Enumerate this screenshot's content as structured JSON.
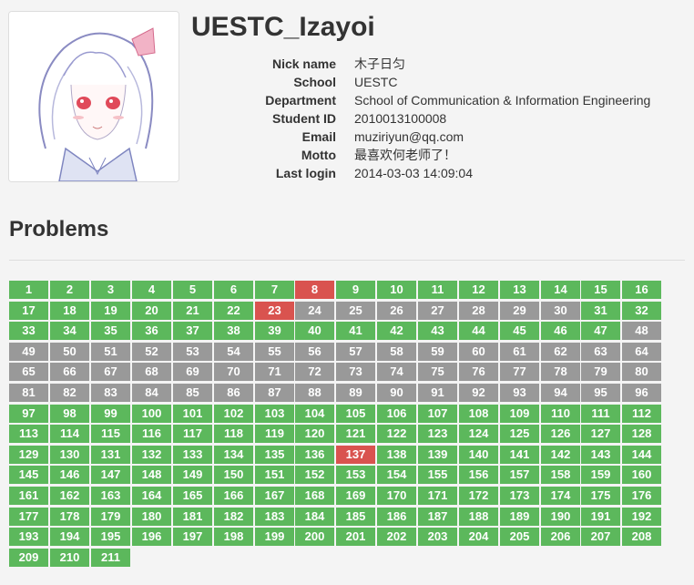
{
  "profile": {
    "username": "UESTC_Izayoi",
    "fields": [
      {
        "label": "Nick name",
        "value": "木子日匀"
      },
      {
        "label": "School",
        "value": "UESTC"
      },
      {
        "label": "Department",
        "value": "School of Communication & Information Engineering"
      },
      {
        "label": "Student ID",
        "value": "2010013100008"
      },
      {
        "label": "Email",
        "value": "muziriyun@qq.com"
      },
      {
        "label": "Motto",
        "value": "最喜欢何老师了！"
      },
      {
        "label": "Last login",
        "value": "2014-03-03 14:09:04"
      }
    ]
  },
  "problems": {
    "title": "Problems",
    "columns": 16,
    "colors": {
      "solved": "#5cb85c",
      "failed": "#d9534f",
      "unseen": "#999999"
    },
    "items": [
      {
        "id": "1",
        "status": "solved"
      },
      {
        "id": "2",
        "status": "solved"
      },
      {
        "id": "3",
        "status": "solved"
      },
      {
        "id": "4",
        "status": "solved"
      },
      {
        "id": "5",
        "status": "solved"
      },
      {
        "id": "6",
        "status": "solved"
      },
      {
        "id": "7",
        "status": "solved"
      },
      {
        "id": "8",
        "status": "failed"
      },
      {
        "id": "9",
        "status": "solved"
      },
      {
        "id": "10",
        "status": "solved"
      },
      {
        "id": "11",
        "status": "solved"
      },
      {
        "id": "12",
        "status": "solved"
      },
      {
        "id": "13",
        "status": "solved"
      },
      {
        "id": "14",
        "status": "solved"
      },
      {
        "id": "15",
        "status": "solved"
      },
      {
        "id": "16",
        "status": "solved"
      },
      {
        "id": "17",
        "status": "solved"
      },
      {
        "id": "18",
        "status": "solved"
      },
      {
        "id": "19",
        "status": "solved"
      },
      {
        "id": "20",
        "status": "solved"
      },
      {
        "id": "21",
        "status": "solved"
      },
      {
        "id": "22",
        "status": "solved"
      },
      {
        "id": "23",
        "status": "failed"
      },
      {
        "id": "24",
        "status": "unseen"
      },
      {
        "id": "25",
        "status": "unseen"
      },
      {
        "id": "26",
        "status": "unseen"
      },
      {
        "id": "27",
        "status": "unseen"
      },
      {
        "id": "28",
        "status": "unseen"
      },
      {
        "id": "29",
        "status": "unseen"
      },
      {
        "id": "30",
        "status": "unseen"
      },
      {
        "id": "31",
        "status": "solved"
      },
      {
        "id": "32",
        "status": "solved"
      },
      {
        "id": "33",
        "status": "solved"
      },
      {
        "id": "34",
        "status": "solved"
      },
      {
        "id": "35",
        "status": "solved"
      },
      {
        "id": "36",
        "status": "solved"
      },
      {
        "id": "37",
        "status": "solved"
      },
      {
        "id": "38",
        "status": "solved"
      },
      {
        "id": "39",
        "status": "solved"
      },
      {
        "id": "40",
        "status": "solved"
      },
      {
        "id": "41",
        "status": "solved"
      },
      {
        "id": "42",
        "status": "solved"
      },
      {
        "id": "43",
        "status": "solved"
      },
      {
        "id": "44",
        "status": "solved"
      },
      {
        "id": "45",
        "status": "solved"
      },
      {
        "id": "46",
        "status": "solved"
      },
      {
        "id": "47",
        "status": "solved"
      },
      {
        "id": "48",
        "status": "unseen"
      },
      {
        "id": "49",
        "status": "unseen"
      },
      {
        "id": "50",
        "status": "unseen"
      },
      {
        "id": "51",
        "status": "unseen"
      },
      {
        "id": "52",
        "status": "unseen"
      },
      {
        "id": "53",
        "status": "unseen"
      },
      {
        "id": "54",
        "status": "unseen"
      },
      {
        "id": "55",
        "status": "unseen"
      },
      {
        "id": "56",
        "status": "unseen"
      },
      {
        "id": "57",
        "status": "unseen"
      },
      {
        "id": "58",
        "status": "unseen"
      },
      {
        "id": "59",
        "status": "unseen"
      },
      {
        "id": "60",
        "status": "unseen"
      },
      {
        "id": "61",
        "status": "unseen"
      },
      {
        "id": "62",
        "status": "unseen"
      },
      {
        "id": "63",
        "status": "unseen"
      },
      {
        "id": "64",
        "status": "unseen"
      },
      {
        "id": "65",
        "status": "unseen"
      },
      {
        "id": "66",
        "status": "unseen"
      },
      {
        "id": "67",
        "status": "unseen"
      },
      {
        "id": "68",
        "status": "unseen"
      },
      {
        "id": "69",
        "status": "unseen"
      },
      {
        "id": "70",
        "status": "unseen"
      },
      {
        "id": "71",
        "status": "unseen"
      },
      {
        "id": "72",
        "status": "unseen"
      },
      {
        "id": "73",
        "status": "unseen"
      },
      {
        "id": "74",
        "status": "unseen"
      },
      {
        "id": "75",
        "status": "unseen"
      },
      {
        "id": "76",
        "status": "unseen"
      },
      {
        "id": "77",
        "status": "unseen"
      },
      {
        "id": "78",
        "status": "unseen"
      },
      {
        "id": "79",
        "status": "unseen"
      },
      {
        "id": "80",
        "status": "unseen"
      },
      {
        "id": "81",
        "status": "unseen"
      },
      {
        "id": "82",
        "status": "unseen"
      },
      {
        "id": "83",
        "status": "unseen"
      },
      {
        "id": "84",
        "status": "unseen"
      },
      {
        "id": "85",
        "status": "unseen"
      },
      {
        "id": "86",
        "status": "unseen"
      },
      {
        "id": "87",
        "status": "unseen"
      },
      {
        "id": "88",
        "status": "unseen"
      },
      {
        "id": "89",
        "status": "unseen"
      },
      {
        "id": "90",
        "status": "unseen"
      },
      {
        "id": "91",
        "status": "unseen"
      },
      {
        "id": "92",
        "status": "unseen"
      },
      {
        "id": "93",
        "status": "unseen"
      },
      {
        "id": "94",
        "status": "unseen"
      },
      {
        "id": "95",
        "status": "unseen"
      },
      {
        "id": "96",
        "status": "unseen"
      },
      {
        "id": "97",
        "status": "solved"
      },
      {
        "id": "98",
        "status": "solved"
      },
      {
        "id": "99",
        "status": "solved"
      },
      {
        "id": "100",
        "status": "solved"
      },
      {
        "id": "101",
        "status": "solved"
      },
      {
        "id": "102",
        "status": "solved"
      },
      {
        "id": "103",
        "status": "solved"
      },
      {
        "id": "104",
        "status": "solved"
      },
      {
        "id": "105",
        "status": "solved"
      },
      {
        "id": "106",
        "status": "solved"
      },
      {
        "id": "107",
        "status": "solved"
      },
      {
        "id": "108",
        "status": "solved"
      },
      {
        "id": "109",
        "status": "solved"
      },
      {
        "id": "110",
        "status": "solved"
      },
      {
        "id": "111",
        "status": "solved"
      },
      {
        "id": "112",
        "status": "solved"
      },
      {
        "id": "113",
        "status": "solved"
      },
      {
        "id": "114",
        "status": "solved"
      },
      {
        "id": "115",
        "status": "solved"
      },
      {
        "id": "116",
        "status": "solved"
      },
      {
        "id": "117",
        "status": "solved"
      },
      {
        "id": "118",
        "status": "solved"
      },
      {
        "id": "119",
        "status": "solved"
      },
      {
        "id": "120",
        "status": "solved"
      },
      {
        "id": "121",
        "status": "solved"
      },
      {
        "id": "122",
        "status": "solved"
      },
      {
        "id": "123",
        "status": "solved"
      },
      {
        "id": "124",
        "status": "solved"
      },
      {
        "id": "125",
        "status": "solved"
      },
      {
        "id": "126",
        "status": "solved"
      },
      {
        "id": "127",
        "status": "solved"
      },
      {
        "id": "128",
        "status": "solved"
      },
      {
        "id": "129",
        "status": "solved"
      },
      {
        "id": "130",
        "status": "solved"
      },
      {
        "id": "131",
        "status": "solved"
      },
      {
        "id": "132",
        "status": "solved"
      },
      {
        "id": "133",
        "status": "solved"
      },
      {
        "id": "134",
        "status": "solved"
      },
      {
        "id": "135",
        "status": "solved"
      },
      {
        "id": "136",
        "status": "solved"
      },
      {
        "id": "137",
        "status": "failed"
      },
      {
        "id": "138",
        "status": "solved"
      },
      {
        "id": "139",
        "status": "solved"
      },
      {
        "id": "140",
        "status": "solved"
      },
      {
        "id": "141",
        "status": "solved"
      },
      {
        "id": "142",
        "status": "solved"
      },
      {
        "id": "143",
        "status": "solved"
      },
      {
        "id": "144",
        "status": "solved"
      },
      {
        "id": "145",
        "status": "solved"
      },
      {
        "id": "146",
        "status": "solved"
      },
      {
        "id": "147",
        "status": "solved"
      },
      {
        "id": "148",
        "status": "solved"
      },
      {
        "id": "149",
        "status": "solved"
      },
      {
        "id": "150",
        "status": "solved"
      },
      {
        "id": "151",
        "status": "solved"
      },
      {
        "id": "152",
        "status": "solved"
      },
      {
        "id": "153",
        "status": "solved"
      },
      {
        "id": "154",
        "status": "solved"
      },
      {
        "id": "155",
        "status": "solved"
      },
      {
        "id": "156",
        "status": "solved"
      },
      {
        "id": "157",
        "status": "solved"
      },
      {
        "id": "158",
        "status": "solved"
      },
      {
        "id": "159",
        "status": "solved"
      },
      {
        "id": "160",
        "status": "solved"
      },
      {
        "id": "161",
        "status": "solved"
      },
      {
        "id": "162",
        "status": "solved"
      },
      {
        "id": "163",
        "status": "solved"
      },
      {
        "id": "164",
        "status": "solved"
      },
      {
        "id": "165",
        "status": "solved"
      },
      {
        "id": "166",
        "status": "solved"
      },
      {
        "id": "167",
        "status": "solved"
      },
      {
        "id": "168",
        "status": "solved"
      },
      {
        "id": "169",
        "status": "solved"
      },
      {
        "id": "170",
        "status": "solved"
      },
      {
        "id": "171",
        "status": "solved"
      },
      {
        "id": "172",
        "status": "solved"
      },
      {
        "id": "173",
        "status": "solved"
      },
      {
        "id": "174",
        "status": "solved"
      },
      {
        "id": "175",
        "status": "solved"
      },
      {
        "id": "176",
        "status": "solved"
      },
      {
        "id": "177",
        "status": "solved"
      },
      {
        "id": "178",
        "status": "solved"
      },
      {
        "id": "179",
        "status": "solved"
      },
      {
        "id": "180",
        "status": "solved"
      },
      {
        "id": "181",
        "status": "solved"
      },
      {
        "id": "182",
        "status": "solved"
      },
      {
        "id": "183",
        "status": "solved"
      },
      {
        "id": "184",
        "status": "solved"
      },
      {
        "id": "185",
        "status": "solved"
      },
      {
        "id": "186",
        "status": "solved"
      },
      {
        "id": "187",
        "status": "solved"
      },
      {
        "id": "188",
        "status": "solved"
      },
      {
        "id": "189",
        "status": "solved"
      },
      {
        "id": "190",
        "status": "solved"
      },
      {
        "id": "191",
        "status": "solved"
      },
      {
        "id": "192",
        "status": "solved"
      },
      {
        "id": "193",
        "status": "solved"
      },
      {
        "id": "194",
        "status": "solved"
      },
      {
        "id": "195",
        "status": "solved"
      },
      {
        "id": "196",
        "status": "solved"
      },
      {
        "id": "197",
        "status": "solved"
      },
      {
        "id": "198",
        "status": "solved"
      },
      {
        "id": "199",
        "status": "solved"
      },
      {
        "id": "200",
        "status": "solved"
      },
      {
        "id": "201",
        "status": "solved"
      },
      {
        "id": "202",
        "status": "solved"
      },
      {
        "id": "203",
        "status": "solved"
      },
      {
        "id": "204",
        "status": "solved"
      },
      {
        "id": "205",
        "status": "solved"
      },
      {
        "id": "206",
        "status": "solved"
      },
      {
        "id": "207",
        "status": "solved"
      },
      {
        "id": "208",
        "status": "solved"
      },
      {
        "id": "209",
        "status": "solved"
      },
      {
        "id": "210",
        "status": "solved"
      },
      {
        "id": "211",
        "status": "solved"
      }
    ]
  }
}
